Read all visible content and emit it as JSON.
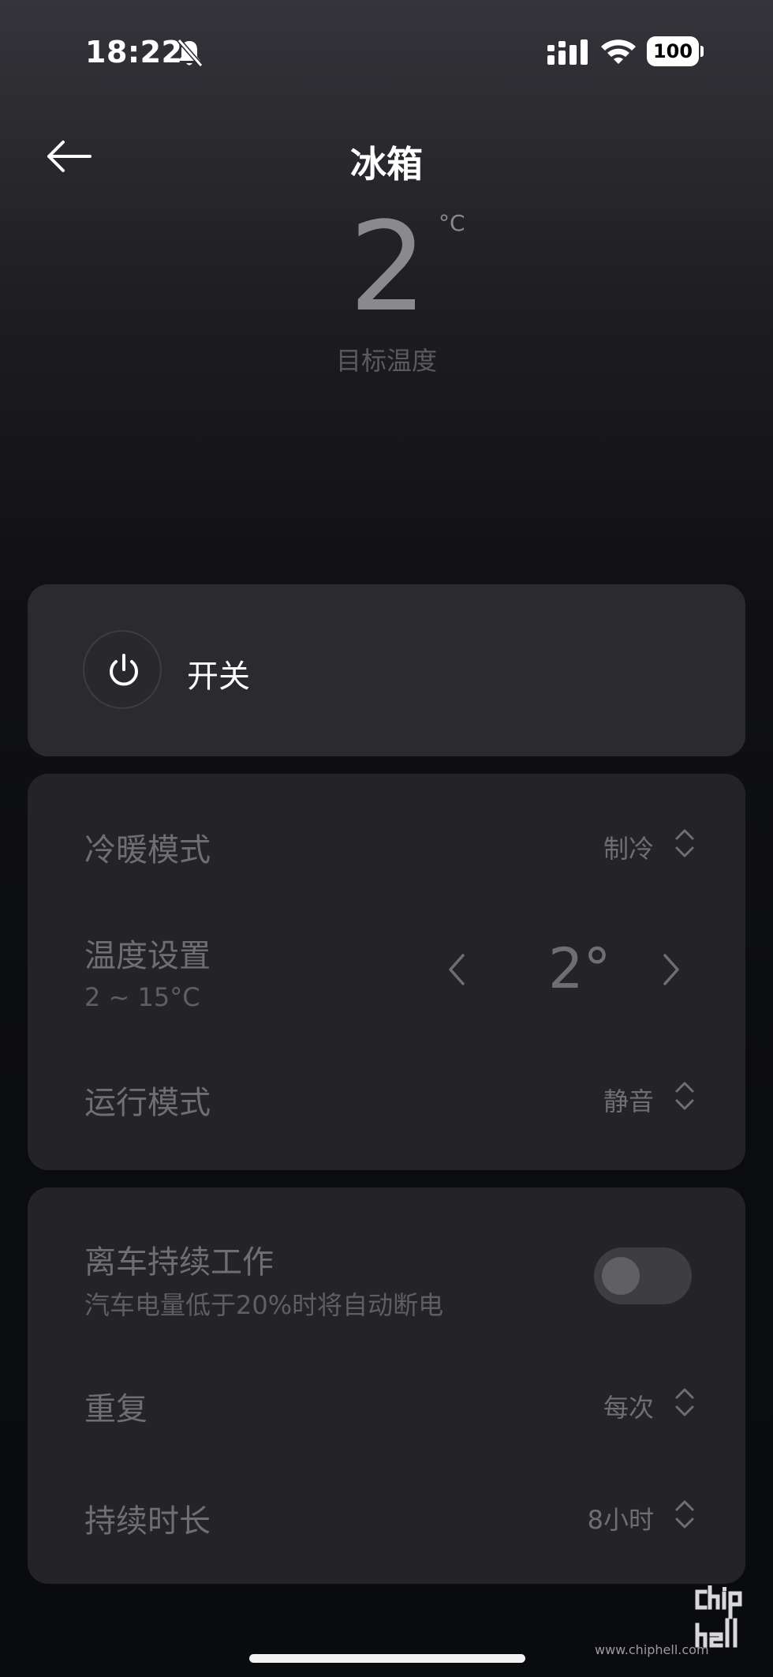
{
  "status_bar": {
    "time": "18:22",
    "battery": "100",
    "icons": [
      "bell-slash-icon",
      "signal-icon",
      "wifi-icon",
      "battery-icon"
    ]
  },
  "header": {
    "back_icon": "arrow-left-icon",
    "title": "冰箱"
  },
  "target_temp": {
    "value": "2",
    "unit": "°C",
    "label": "目标温度"
  },
  "power": {
    "icon": "power-icon",
    "label": "开关"
  },
  "settings": {
    "mode": {
      "label": "冷暖模式",
      "value": "制冷",
      "icon": "chevron-updown-icon"
    },
    "temperature": {
      "label": "温度设置",
      "range": "2 ~ 15°C",
      "value": "2°",
      "decrease_icon": "chevron-left-icon",
      "increase_icon": "chevron-right-icon"
    },
    "run_mode": {
      "label": "运行模式",
      "value": "静音",
      "icon": "chevron-updown-icon"
    }
  },
  "extra": {
    "keep_working": {
      "label": "离车持续工作",
      "sub": "汽车电量低于20%时将自动断电",
      "enabled": false
    },
    "repeat": {
      "label": "重复",
      "value": "每次",
      "icon": "chevron-updown-icon"
    },
    "duration": {
      "label": "持续时长",
      "value": "8小时",
      "icon": "chevron-updown-icon"
    }
  },
  "watermark": {
    "logo_text": "chiphell",
    "url": "www.chiphell.com"
  },
  "colors": {
    "card": "#2a2a2e",
    "text_dim": "#6e6e74",
    "text_bright": "#ffffff"
  }
}
